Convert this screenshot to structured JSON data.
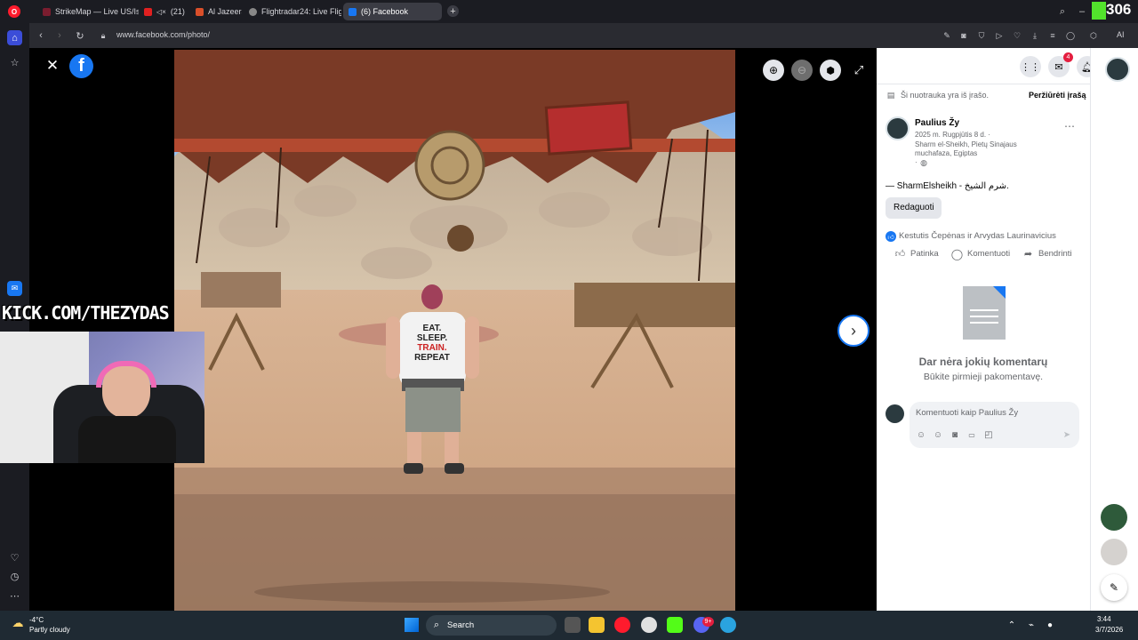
{
  "tabs": [
    {
      "label": "StrikeMap — Live US/Israe",
      "color": "#7b1d2f"
    },
    {
      "label": "(21)",
      "color": "#e02020"
    },
    {
      "label": "Al Jazeera Eng",
      "color": "#d94f2a"
    },
    {
      "label": "Flightradar24: Live Flight",
      "color": "#888888"
    },
    {
      "label": "(6) Facebook",
      "color": "#1877f2"
    }
  ],
  "top_right_counter": "306",
  "address": {
    "url": "www.facebook.com/photo/",
    "ai_label": "AI"
  },
  "stream_overlay": {
    "kick_text": "KICK.COM/THEZYDAS",
    "corner_letter": "N"
  },
  "viewer": {
    "close_icon": "close-icon",
    "tshirt_text": [
      "EAT.",
      "SLEEP.",
      "TRAIN.",
      "REPEAT"
    ]
  },
  "header_badges": {
    "messenger": "4",
    "notifications": "2"
  },
  "post": {
    "notice": "Ši nuotrauka yra iš įrašo.",
    "view_post": "Peržiūrėti įrašą",
    "author": "Paulius Žy",
    "date": "2025 m. Rugpjūtis 8 d. ·",
    "location_line1": "Sharm el-Sheikh, Pietų Sinajaus",
    "location_line2": "muchafaza, Egiptas",
    "privacy_prefix": "·",
    "caption": "— SharmElsheikh - شرم الشيخ.",
    "edit_button": "Redaguoti",
    "reactions_text": "Kestutis Čepėnas ir Arvydas Laurinavicius",
    "actions": {
      "like": "Patinka",
      "comment": "Komentuoti",
      "share": "Bendrinti"
    },
    "no_comments_title": "Dar nėra jokių komentarų",
    "no_comments_sub": "Būkite pirmieji pakomentavę.",
    "comment_placeholder": "Komentuoti kaip Paulius Žy"
  },
  "taskbar": {
    "weather_temp": "-4°C",
    "weather_desc": "Partly cloudy",
    "search_label": "Search",
    "time": "3:44",
    "date": "3/7/2026",
    "msg_badge": "9+"
  }
}
